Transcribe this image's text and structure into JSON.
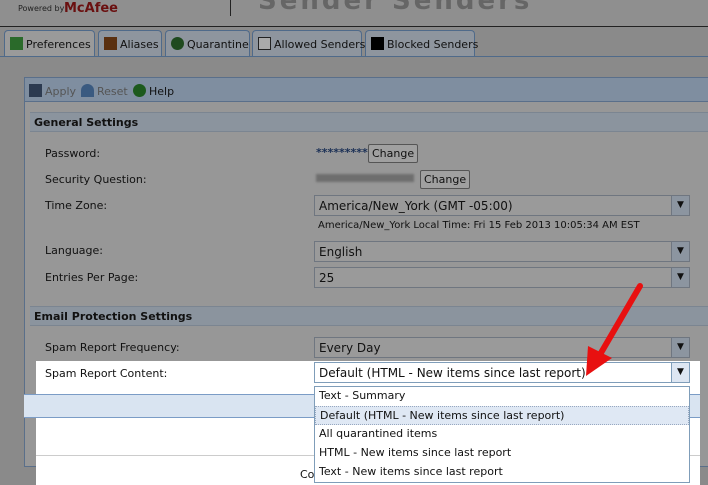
{
  "header": {
    "powered_by": "Powered by",
    "brand": "McAfee",
    "title": "Sender Senders"
  },
  "tabs": [
    {
      "label": "Preferences",
      "active": true
    },
    {
      "label": "Aliases"
    },
    {
      "label": "Quarantine"
    },
    {
      "label": "Allowed Senders"
    },
    {
      "label": "Blocked Senders"
    }
  ],
  "toolbar": {
    "apply": "Apply",
    "reset": "Reset",
    "help": "Help"
  },
  "general": {
    "title": "General Settings",
    "password_label": "Password:",
    "password_value": "*********",
    "change": "Change",
    "question_label": "Security Question:",
    "timezone_label": "Time Zone:",
    "timezone_value": "America/New_York (GMT -05:00)",
    "local_time": "America/New_York Local Time: Fri 15 Feb 2013 10:05:34 AM EST",
    "language_label": "Language:",
    "language_value": "English",
    "entries_label": "Entries Per Page:",
    "entries_value": "25"
  },
  "email": {
    "title": "Email Protection Settings",
    "frequency_label": "Spam Report Frequency:",
    "frequency_value": "Every Day",
    "content_label": "Spam Report Content:",
    "content_value": "Default (HTML - New items since last report)",
    "content_options": [
      "Text - Summary",
      "Default (HTML - New items since last report)",
      "All quarantined items",
      "HTML - New items since last report",
      "Text - New items since last report"
    ]
  },
  "footer": {
    "text": "Co"
  },
  "colors": {
    "accent": "#e81010",
    "highlight": "#dfe8f4"
  }
}
